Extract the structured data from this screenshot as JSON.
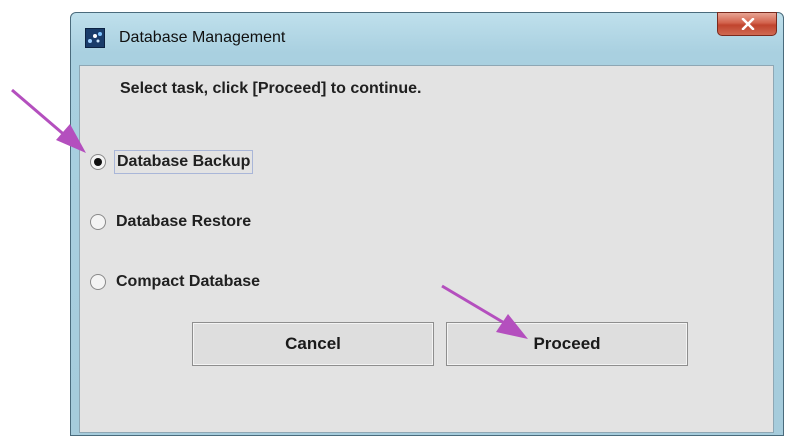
{
  "window": {
    "title": "Database Management"
  },
  "dialog": {
    "instruction": "Select task, click [Proceed] to continue.",
    "options": [
      {
        "label": "Database Backup",
        "selected": true
      },
      {
        "label": "Database Restore",
        "selected": false
      },
      {
        "label": "Compact Database",
        "selected": false
      }
    ],
    "buttons": {
      "cancel": "Cancel",
      "proceed": "Proceed"
    }
  },
  "colors": {
    "annotation_arrow": "#b44fbe",
    "close_button": "#c9503a",
    "titlebar": "#a9d0e0"
  },
  "icons": {
    "app": "app-icon",
    "close": "close-icon"
  }
}
